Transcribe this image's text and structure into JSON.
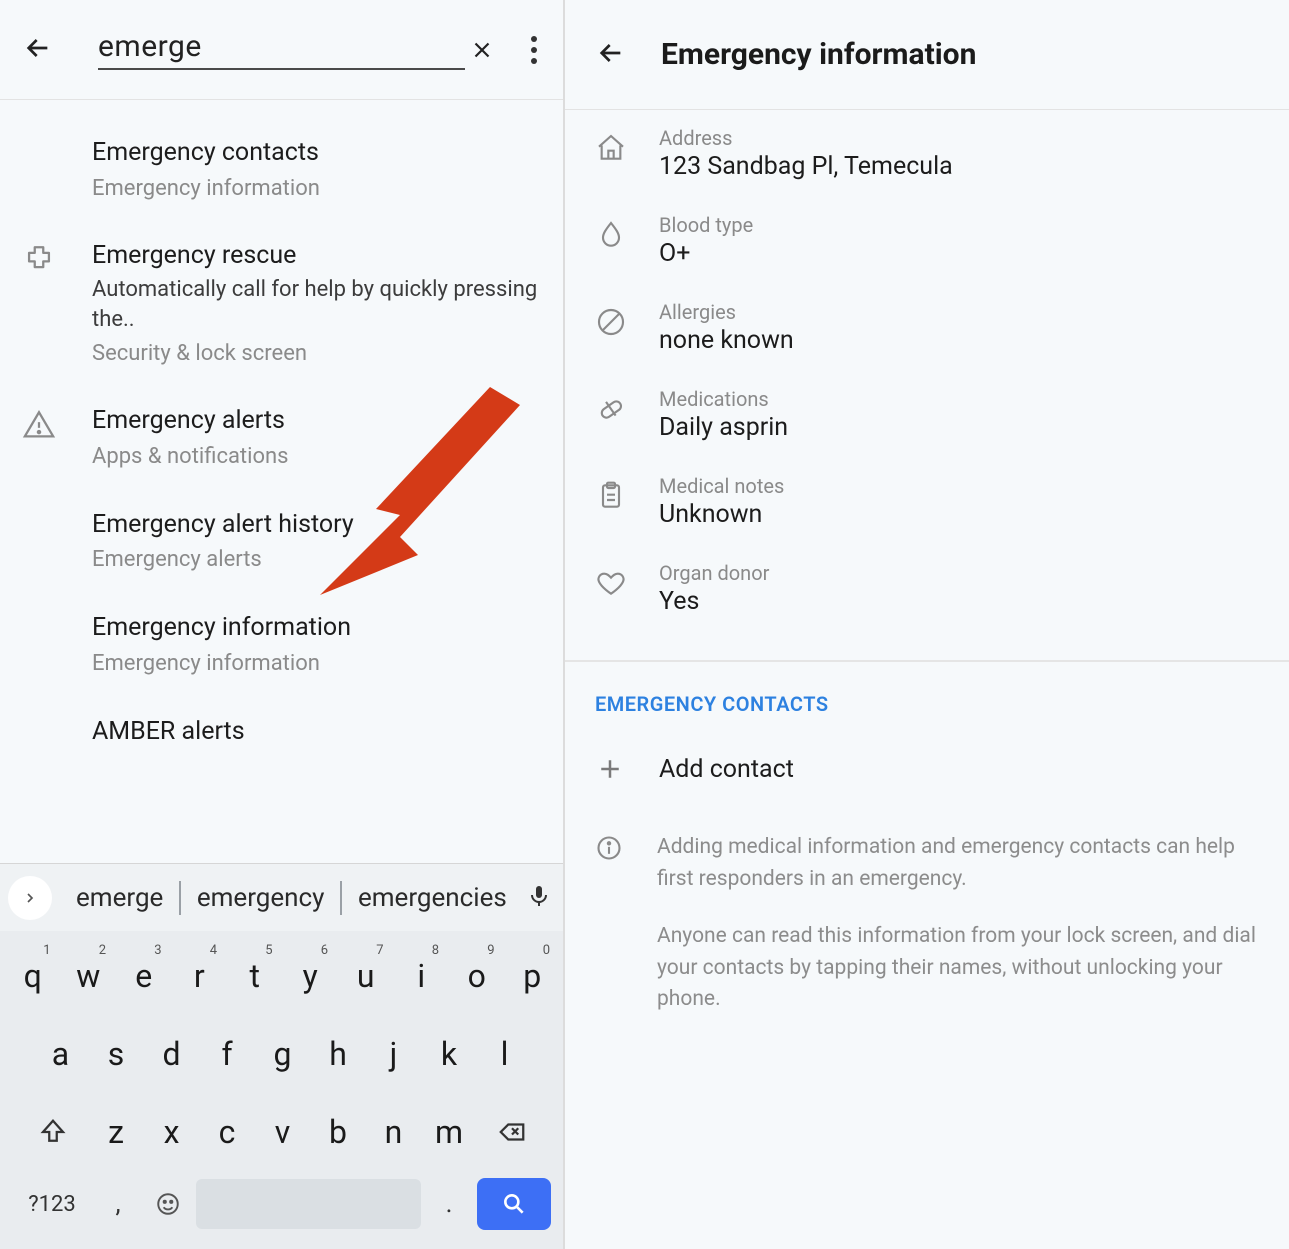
{
  "left": {
    "search_value": "emerge",
    "results": [
      {
        "title": "Emergency contacts",
        "sub": "Emergency information"
      },
      {
        "title": "Emergency rescue",
        "desc": "Automatically call for help by quickly pressing the..",
        "sub": "Security & lock screen"
      },
      {
        "title": "Emergency alerts",
        "sub": "Apps & notifications"
      },
      {
        "title": "Emergency alert history",
        "sub": "Emergency alerts"
      },
      {
        "title": "Emergency information",
        "sub": "Emergency information"
      },
      {
        "title": "AMBER alerts"
      }
    ],
    "suggestions": [
      "emerge",
      "emergency",
      "emergencies"
    ],
    "keyboard": {
      "row1": [
        "q",
        "w",
        "e",
        "r",
        "t",
        "y",
        "u",
        "i",
        "o",
        "p"
      ],
      "row1_sup": [
        "1",
        "2",
        "3",
        "4",
        "5",
        "6",
        "7",
        "8",
        "9",
        "0"
      ],
      "row2": [
        "a",
        "s",
        "d",
        "f",
        "g",
        "h",
        "j",
        "k",
        "l"
      ],
      "row3": [
        "z",
        "x",
        "c",
        "v",
        "b",
        "n",
        "m"
      ],
      "sym": "?123",
      "comma": ",",
      "period": "."
    }
  },
  "right": {
    "title": "Emergency information",
    "items": [
      {
        "label": "Address",
        "value": "123 Sandbag Pl, Temecula"
      },
      {
        "label": "Blood type",
        "value": "O+"
      },
      {
        "label": "Allergies",
        "value": "none known"
      },
      {
        "label": "Medications",
        "value": "Daily asprin"
      },
      {
        "label": "Medical notes",
        "value": "Unknown"
      },
      {
        "label": "Organ donor",
        "value": "Yes"
      }
    ],
    "section": "EMERGENCY CONTACTS",
    "add_contact": "Add contact",
    "hint1": "Adding medical information and emergency contacts can help first responders in an emergency.",
    "hint2": "Anyone can read this information from your lock screen, and dial your contacts by tapping their names, without unlocking your phone."
  }
}
